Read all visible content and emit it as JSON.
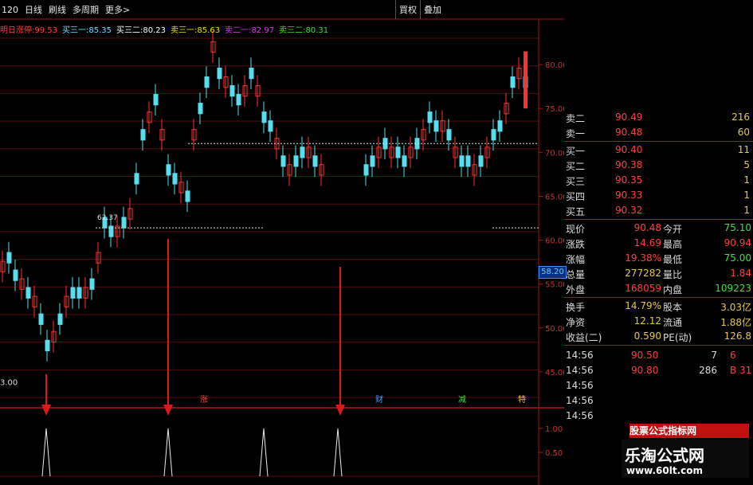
{
  "toolbar": {
    "period_code": "120",
    "daily": "日线",
    "minute": "刷线",
    "multi_cycle": "多周期",
    "more": "更多>",
    "right_buttons": [
      "買权",
      "叠加"
    ]
  },
  "legend": [
    {
      "label": "明日涨停",
      "value": "99.53",
      "color": "#ff4040"
    },
    {
      "label": "买三一",
      "value": "85.35",
      "color": "#6be0ff"
    },
    {
      "label": "买三二",
      "value": "80.23",
      "color": "#ffffff"
    },
    {
      "label": "卖三一",
      "value": "85.63",
      "color": "#e8e000"
    },
    {
      "label": "卖二一",
      "value": "82.97",
      "color": "#d040e0"
    },
    {
      "label": "卖三二",
      "value": "80.31",
      "color": "#40e040"
    }
  ],
  "price_axis": {
    "ticks": [
      "80.00",
      "75.00",
      "70.00",
      "65.00",
      "60.00",
      "55.00",
      "50.00",
      "45.00"
    ],
    "current_marker": "58.20"
  },
  "indicator_axis": {
    "ticks": [
      "1.00",
      "0.50"
    ]
  },
  "chart_annotations": {
    "level_high": "62.37",
    "level_low": "3.00"
  },
  "event_markers": [
    {
      "text": "涨",
      "color": "#ff4040"
    },
    {
      "text": "财",
      "color": "#4aa0ff"
    },
    {
      "text": "减",
      "color": "#40e040"
    },
    {
      "text": "特",
      "color": "#ffcc33"
    }
  ],
  "order_book": {
    "asks": [
      {
        "label": "卖二",
        "price": "90.49",
        "volume": "216"
      },
      {
        "label": "卖一",
        "price": "90.48",
        "volume": "60"
      }
    ],
    "bids": [
      {
        "label": "买一",
        "price": "90.40",
        "volume": "11"
      },
      {
        "label": "买二",
        "price": "90.38",
        "volume": "5"
      },
      {
        "label": "买三",
        "price": "90.35",
        "volume": "1"
      },
      {
        "label": "买四",
        "price": "90.33",
        "volume": "1"
      },
      {
        "label": "买五",
        "price": "90.32",
        "volume": "1"
      }
    ]
  },
  "stats": [
    {
      "l": "现价",
      "lv": "90.48",
      "lc": "#ff4040",
      "r": "今开",
      "rv": "75.10",
      "rc": "#40e040"
    },
    {
      "l": "涨跌",
      "lv": "14.69",
      "lc": "#ff4040",
      "r": "最高",
      "rv": "90.94",
      "rc": "#ff4040"
    },
    {
      "l": "涨幅",
      "lv": "19.38%",
      "lc": "#ff4040",
      "r": "最低",
      "rv": "75.00",
      "rc": "#40e040"
    },
    {
      "l": "总量",
      "lv": "277282",
      "lc": "#e8c84a",
      "r": "量比",
      "rv": "1.84",
      "rc": "#ff4040"
    },
    {
      "l": "外盘",
      "lv": "168059",
      "lc": "#ff4040",
      "r": "内盘",
      "rv": "109223",
      "rc": "#40e040"
    },
    {
      "l": "换手",
      "lv": "14.79%",
      "lc": "#e8c84a",
      "r": "股本",
      "rv": "3.03亿",
      "rc": "#e8c84a"
    },
    {
      "l": "净资",
      "lv": "12.12",
      "lc": "#e8c84a",
      "r": "流通",
      "rv": "1.88亿",
      "rc": "#e8c84a"
    },
    {
      "l": "收益(二)",
      "lv": "0.590",
      "lc": "#e8c84a",
      "r": "PE(动)",
      "rv": "126.8",
      "rc": "#e8c84a"
    }
  ],
  "ticks": [
    {
      "time": "14:56",
      "price": "90.50",
      "volume": "7",
      "dir": "6"
    },
    {
      "time": "14:56",
      "price": "90.80",
      "volume": "286",
      "dir": "B 31"
    },
    {
      "time": "14:56",
      "price": "",
      "volume": "",
      "dir": ""
    },
    {
      "time": "14:56",
      "price": "",
      "volume": "",
      "dir": ""
    },
    {
      "time": "14:56",
      "price": "",
      "volume": "",
      "dir": ""
    }
  ],
  "watermark": {
    "banner": "股票公式指标网",
    "title": "乐淘公式网",
    "url": "www.60lt.com"
  },
  "chart_data": {
    "type": "candlestick",
    "ylim": [
      42,
      83
    ],
    "indicator": {
      "type": "signal-spikes",
      "ylim": [
        0,
        1
      ],
      "signals_at": [
        17,
        67,
        107,
        140
      ]
    }
  }
}
